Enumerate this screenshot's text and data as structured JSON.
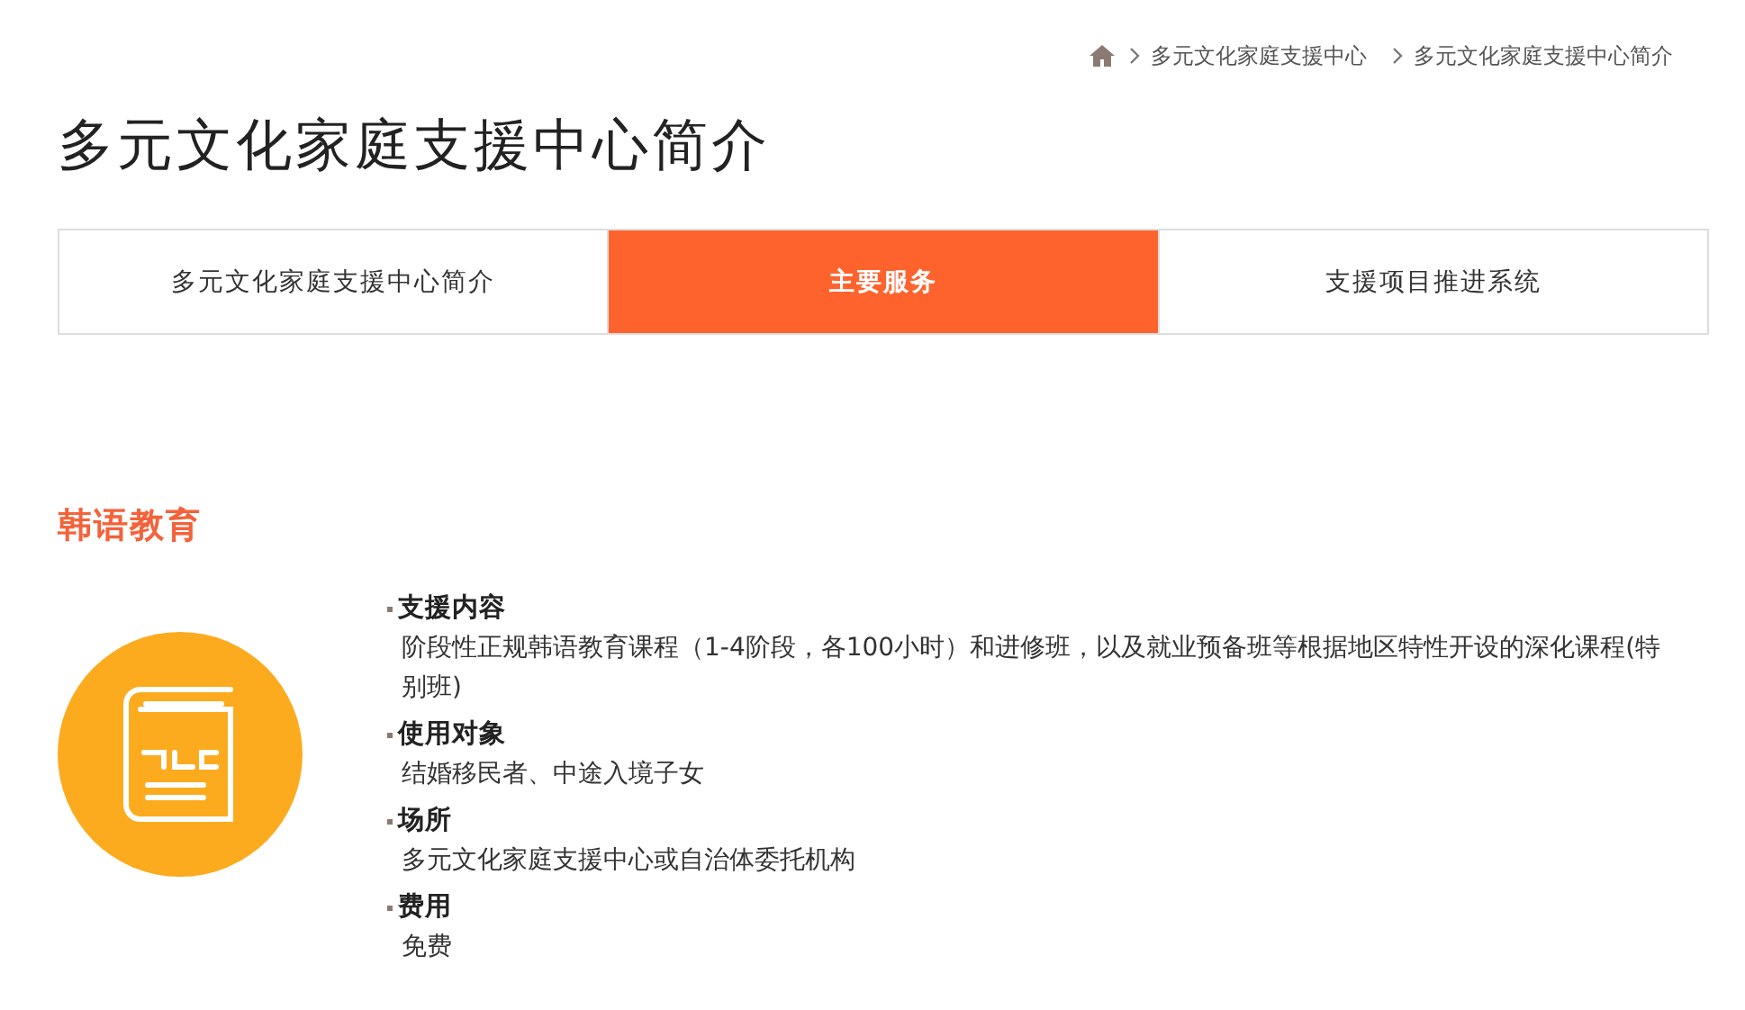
{
  "breadcrumb": [
    "多元文化家庭支援中心",
    "多元文化家庭支援中心简介"
  ],
  "title": "多元文化家庭支援中心简介",
  "tabs": [
    {
      "label": "多元文化家庭支援中心简介",
      "selected": false
    },
    {
      "label": "主要服务",
      "selected": true
    },
    {
      "label": "支援项目推进系统",
      "selected": false
    }
  ],
  "section": {
    "title": "韩语教育",
    "items": [
      {
        "label": "支援内容",
        "text": "阶段性正规韩语教育课程（1-4阶段，各100小时）和进修班，以及就业预备班等根据地区特性开设的深化课程(特别班)"
      },
      {
        "label": "使用对象",
        "text": "结婚移民者、中途入境子女"
      },
      {
        "label": "场所",
        "text": "多元文化家庭支援中心或自治体委托机构"
      },
      {
        "label": "费用",
        "text": "免费"
      }
    ]
  }
}
